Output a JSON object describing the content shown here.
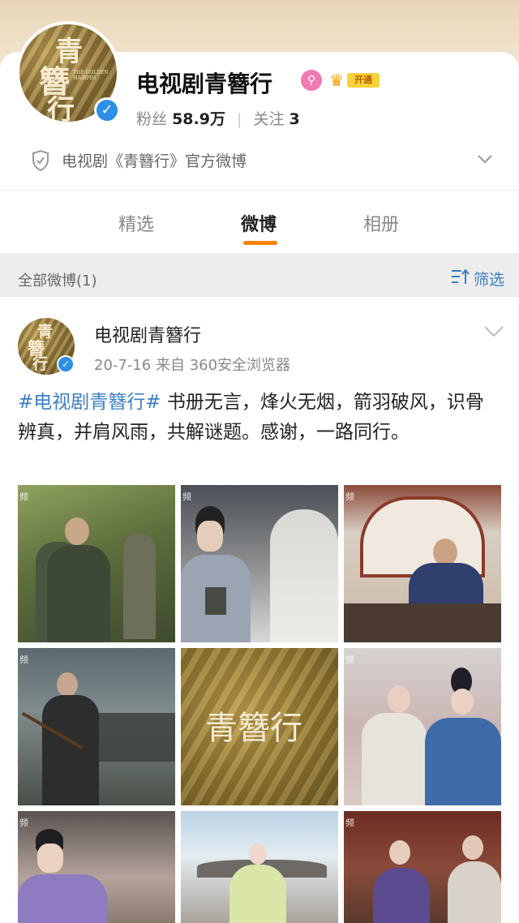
{
  "profile": {
    "name": "电视剧青簪行",
    "avatar_chars": [
      "青",
      "簪",
      "行"
    ],
    "avatar_tag": "THE GOLDEN HAIRPIN",
    "open_badge": "开通",
    "followers_label": "粉丝",
    "followers_value": "58.9万",
    "following_label": "关注",
    "following_value": "3",
    "intro": "电视剧《青簪行》官方微博"
  },
  "tabs": [
    {
      "label": "精选"
    },
    {
      "label": "微博"
    },
    {
      "label": "相册"
    }
  ],
  "filter": {
    "label": "全部微博(1)",
    "button": "筛选"
  },
  "post": {
    "author": "电视剧青簪行",
    "meta": "20-7-16  来自 360安全浏览器",
    "topic": "#电视剧青簪行#",
    "text": " 书册无言，烽火无烟，箭羽破风，识骨辨真，并肩风雨，共解谜题。感谢，一路同行。",
    "images": [
      {
        "watermark": "频",
        "scene": "forest-soldiers"
      },
      {
        "watermark": "频",
        "scene": "scholar-book"
      },
      {
        "watermark": "频",
        "scene": "official-desk"
      },
      {
        "watermark": "频",
        "scene": "archer-crowd"
      },
      {
        "watermark": "",
        "scene": "title-card",
        "title": "青簪行"
      },
      {
        "watermark": "频",
        "scene": "two-ladies"
      },
      {
        "watermark": "频",
        "scene": "young-man-purple"
      },
      {
        "watermark": "",
        "scene": "lady-courtyard"
      },
      {
        "watermark": "频",
        "scene": "palace-group"
      }
    ]
  },
  "colors": {
    "accent": "#ff8200",
    "link": "#3b7fc4",
    "verify": "#2d8fe6",
    "gold": "#f8d23a"
  }
}
